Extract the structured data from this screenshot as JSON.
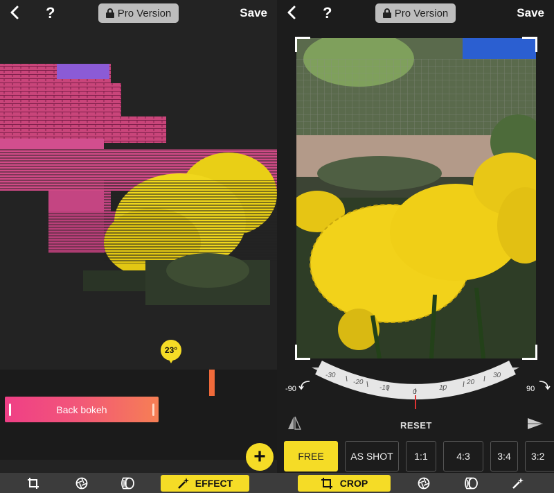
{
  "left": {
    "header": {
      "back_icon": "chevron-left-icon",
      "help_label": "?",
      "pro_label": "Pro Version",
      "save_label": "Save"
    },
    "angle_value": "23°",
    "effect_segment_label": "Back bokeh",
    "add_label": "+",
    "toolbar": {
      "items": [
        {
          "icon": "crop-icon"
        },
        {
          "icon": "aperture-icon"
        },
        {
          "icon": "lens-icon"
        },
        {
          "icon": "magic-wand-icon",
          "label": "EFFECT",
          "active": true
        }
      ]
    }
  },
  "right": {
    "header": {
      "back_icon": "chevron-left-icon",
      "help_label": "?",
      "pro_label": "Pro Version",
      "save_label": "Save"
    },
    "rotate_left_label": "-90",
    "rotate_right_label": "90",
    "dial_ticks": [
      "-30",
      "-20",
      "-10",
      "0",
      "10",
      "20",
      "30"
    ],
    "reset_label": "RESET",
    "ratios": [
      "FREE",
      "AS SHOT",
      "1:1",
      "4:3",
      "3:4",
      "3:2"
    ],
    "active_ratio": "FREE",
    "toolbar": {
      "items": [
        {
          "icon": "crop-icon",
          "label": "CROP",
          "active": true
        },
        {
          "icon": "aperture-icon"
        },
        {
          "icon": "lens-icon"
        },
        {
          "icon": "magic-wand-icon"
        }
      ]
    }
  },
  "colors": {
    "accent_yellow": "#f5dc26",
    "effect_gradient_start": "#ef3f86",
    "effect_gradient_end": "#f67f54",
    "playhead": "#f06a3a"
  }
}
